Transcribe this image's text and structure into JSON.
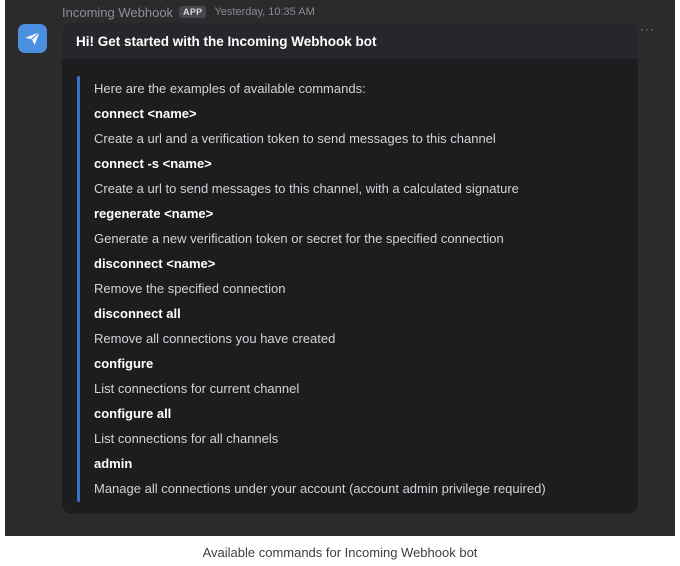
{
  "header": {
    "sender": "Incoming Webhook",
    "badge": "APP",
    "timestamp": "Yesterday, 10:35 AM",
    "more": "···"
  },
  "card": {
    "title": "Hi! Get started with the Incoming Webhook bot",
    "intro": "Here are the examples of available commands:",
    "commands": [
      {
        "command": "connect <name>",
        "description": "Create a url and a verification token to send messages to this channel"
      },
      {
        "command": "connect -s <name>",
        "description": "Create a url to send messages to this channel, with a calculated signature"
      },
      {
        "command": "regenerate <name>",
        "description": "Generate a new verification token or secret for the specified connection"
      },
      {
        "command": "disconnect <name>",
        "description": "Remove the specified connection"
      },
      {
        "command": "disconnect all",
        "description": "Remove all connections you have created"
      },
      {
        "command": "configure",
        "description": "List connections for current channel"
      },
      {
        "command": "configure all",
        "description": "List connections for all channels"
      },
      {
        "command": "admin",
        "description": "Manage all connections under your account (account admin privilege required)"
      }
    ]
  },
  "caption": "Available commands for Incoming Webhook bot",
  "icons": {
    "avatar": "paper-plane-icon",
    "more": "more-horizontal-icon"
  },
  "colors": {
    "accent": "#3c6fc8",
    "avatar_bg": "#4a8fe0",
    "background": "#2b2b2d",
    "card": "#1c1d1f"
  }
}
